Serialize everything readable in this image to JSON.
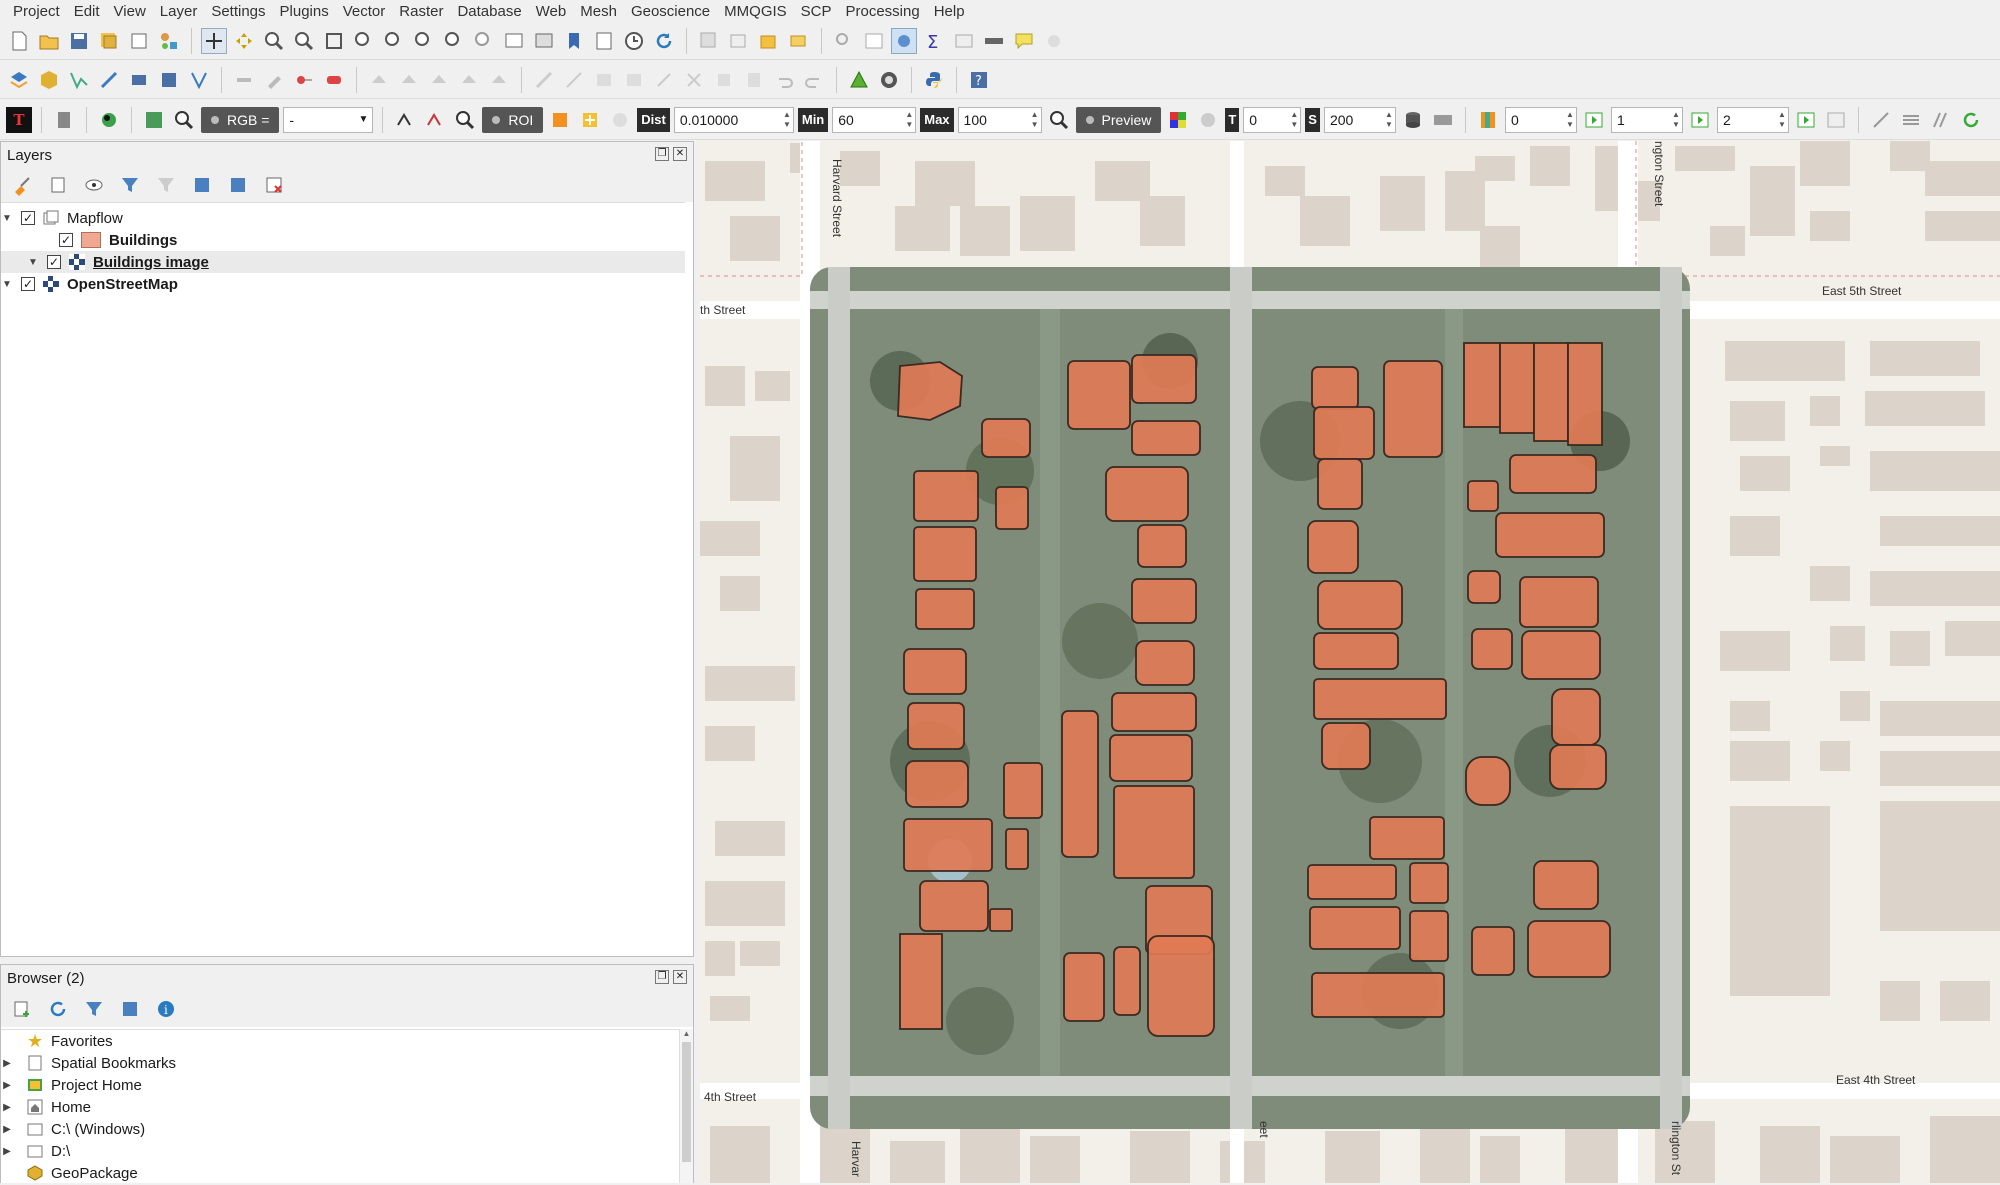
{
  "menubar": {
    "items": [
      "Project",
      "Edit",
      "View",
      "Layer",
      "Settings",
      "Plugins",
      "Vector",
      "Raster",
      "Database",
      "Web",
      "Mesh",
      "Geoscience",
      "MMQGIS",
      "SCP",
      "Processing",
      "Help"
    ]
  },
  "scp_toolbar": {
    "rgb_label": "RGB =",
    "rgb_value": "-",
    "roi_label": "ROI",
    "dist_label": "Dist",
    "dist_value": "0.010000",
    "min_label": "Min",
    "min_value": "60",
    "max_label": "Max",
    "max_value": "100",
    "preview_label": "Preview",
    "t_label": "T",
    "t_value": "0",
    "s_label": "S",
    "s_value": "200",
    "band1_value": "0",
    "band2_value": "1",
    "band3_value": "2"
  },
  "layers_panel": {
    "title": "Layers",
    "tree": [
      {
        "label": "Mapflow",
        "checked": "✓"
      },
      {
        "label": "Buildings",
        "checked": "✓",
        "color": "#e9967a"
      },
      {
        "label": "Buildings image",
        "checked": "✓"
      },
      {
        "label": "OpenStreetMap",
        "checked": "✓"
      }
    ]
  },
  "browser_panel": {
    "title": "Browser (2)",
    "items": [
      {
        "label": "Favorites"
      },
      {
        "label": "Spatial Bookmarks"
      },
      {
        "label": "Project Home"
      },
      {
        "label": "Home"
      },
      {
        "label": "C:\\ (Windows)"
      },
      {
        "label": "D:\\"
      },
      {
        "label": "GeoPackage"
      }
    ]
  },
  "map": {
    "street_labels": {
      "harvard_top": "Harvard Street",
      "harvard_bottom": "Harvar",
      "arlington_top": "ngton Street",
      "arlington_bottom": "rlington St",
      "fifth_left": "th Street",
      "fifth_right": "East 5th Street",
      "fourth_left": "4th Street",
      "fourth_right": "East 4th Street",
      "center_bottom": "eet"
    },
    "colors": {
      "building_fill": "#e07a55",
      "building_stroke": "#3a2a22",
      "osm_background": "#f3efe9",
      "osm_building": "#dcd4cb"
    }
  }
}
